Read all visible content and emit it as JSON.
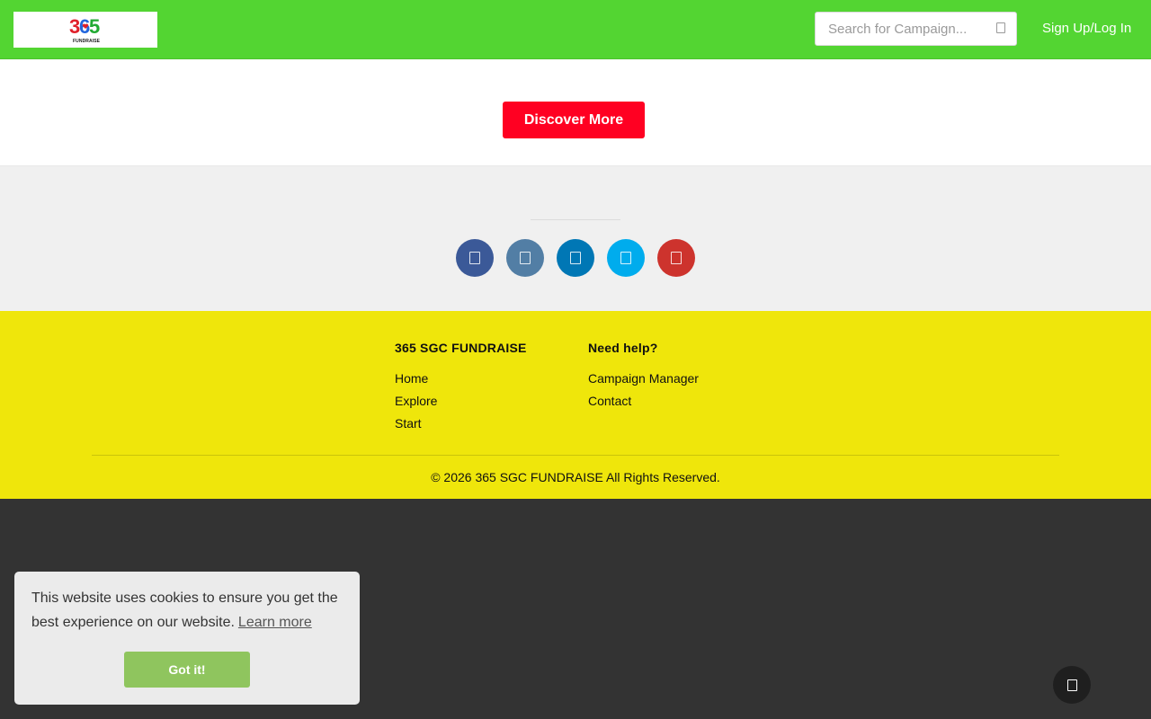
{
  "header": {
    "logo": {
      "number": "365",
      "wordmark": "FUNDRAISE"
    },
    "search": {
      "placeholder": "Search for Campaign...",
      "value": "",
      "icon": "search-icon"
    },
    "signup_label": "Sign Up/Log In"
  },
  "discover": {
    "button_label": "Discover More"
  },
  "social": {
    "buttons": [
      {
        "name": "facebook",
        "icon": "facebook-icon",
        "color": "#3b5998"
      },
      {
        "name": "social-2",
        "icon": "social-icon",
        "color": "#527ea5"
      },
      {
        "name": "linkedin",
        "icon": "linkedin-icon",
        "color": "#0077b5"
      },
      {
        "name": "twitter",
        "icon": "twitter-icon",
        "color": "#00aced"
      },
      {
        "name": "youtube",
        "icon": "youtube-icon",
        "color": "#cd332d"
      }
    ]
  },
  "footer": {
    "columns": [
      {
        "heading": "365 SGC FUNDRAISE",
        "links": [
          "Home",
          "Explore",
          "Start"
        ]
      },
      {
        "heading": "Need help?",
        "links": [
          "Campaign Manager",
          "Contact"
        ]
      }
    ],
    "copyright": "© 2026 365 SGC FUNDRAISE All Rights Reserved."
  },
  "cookie": {
    "message": "This website uses cookies to ensure you get the best experience on our website.",
    "learn_more": "Learn more",
    "button_label": "Got it!"
  },
  "colors": {
    "header_bg": "#53d532",
    "discover_button": "#ff0022",
    "footer_bg": "#efe60b",
    "cookie_button": "#8fc55e",
    "page_bg": "#333333"
  }
}
